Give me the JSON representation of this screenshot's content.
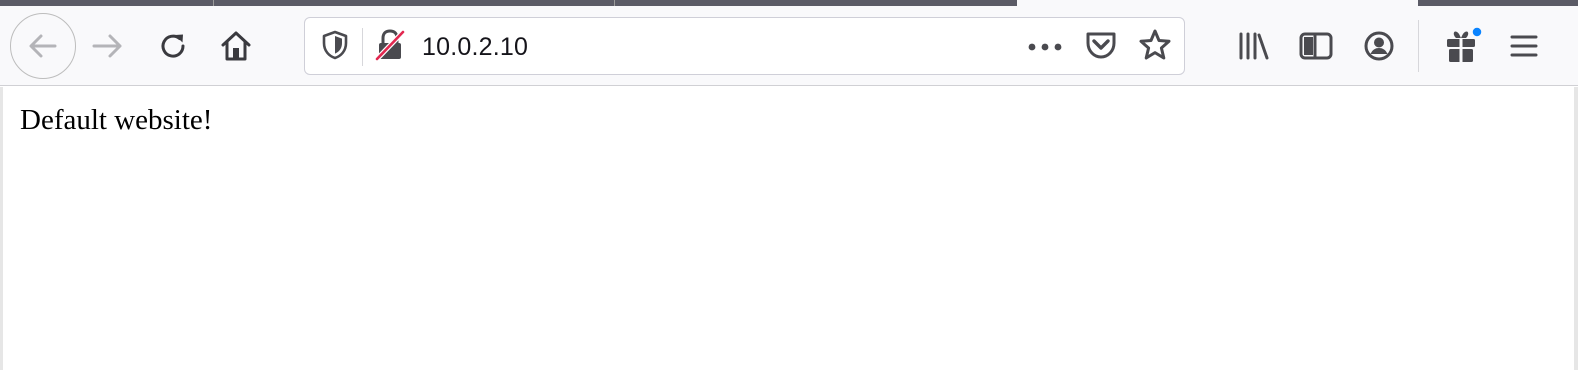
{
  "browser": {
    "address_bar": {
      "url": "10.0.2.10"
    },
    "icons": {
      "back": "back-arrow-icon",
      "forward": "forward-arrow-icon",
      "reload": "reload-icon",
      "home": "home-icon",
      "tracking_protection": "shield-icon",
      "connection": "insecure-lock-icon",
      "page_actions": "more-horizontal-icon",
      "pocket": "pocket-icon",
      "bookmark": "star-icon",
      "library": "library-icon",
      "sidebar": "sidebar-icon",
      "account": "account-icon",
      "whats_new": "gift-icon",
      "menu": "hamburger-menu-icon"
    },
    "colors": {
      "toolbar": "#f9f9fb",
      "insecure_slash": "#e22850",
      "badge": "#0a84ff"
    }
  },
  "page": {
    "body_text": "Default website!"
  }
}
